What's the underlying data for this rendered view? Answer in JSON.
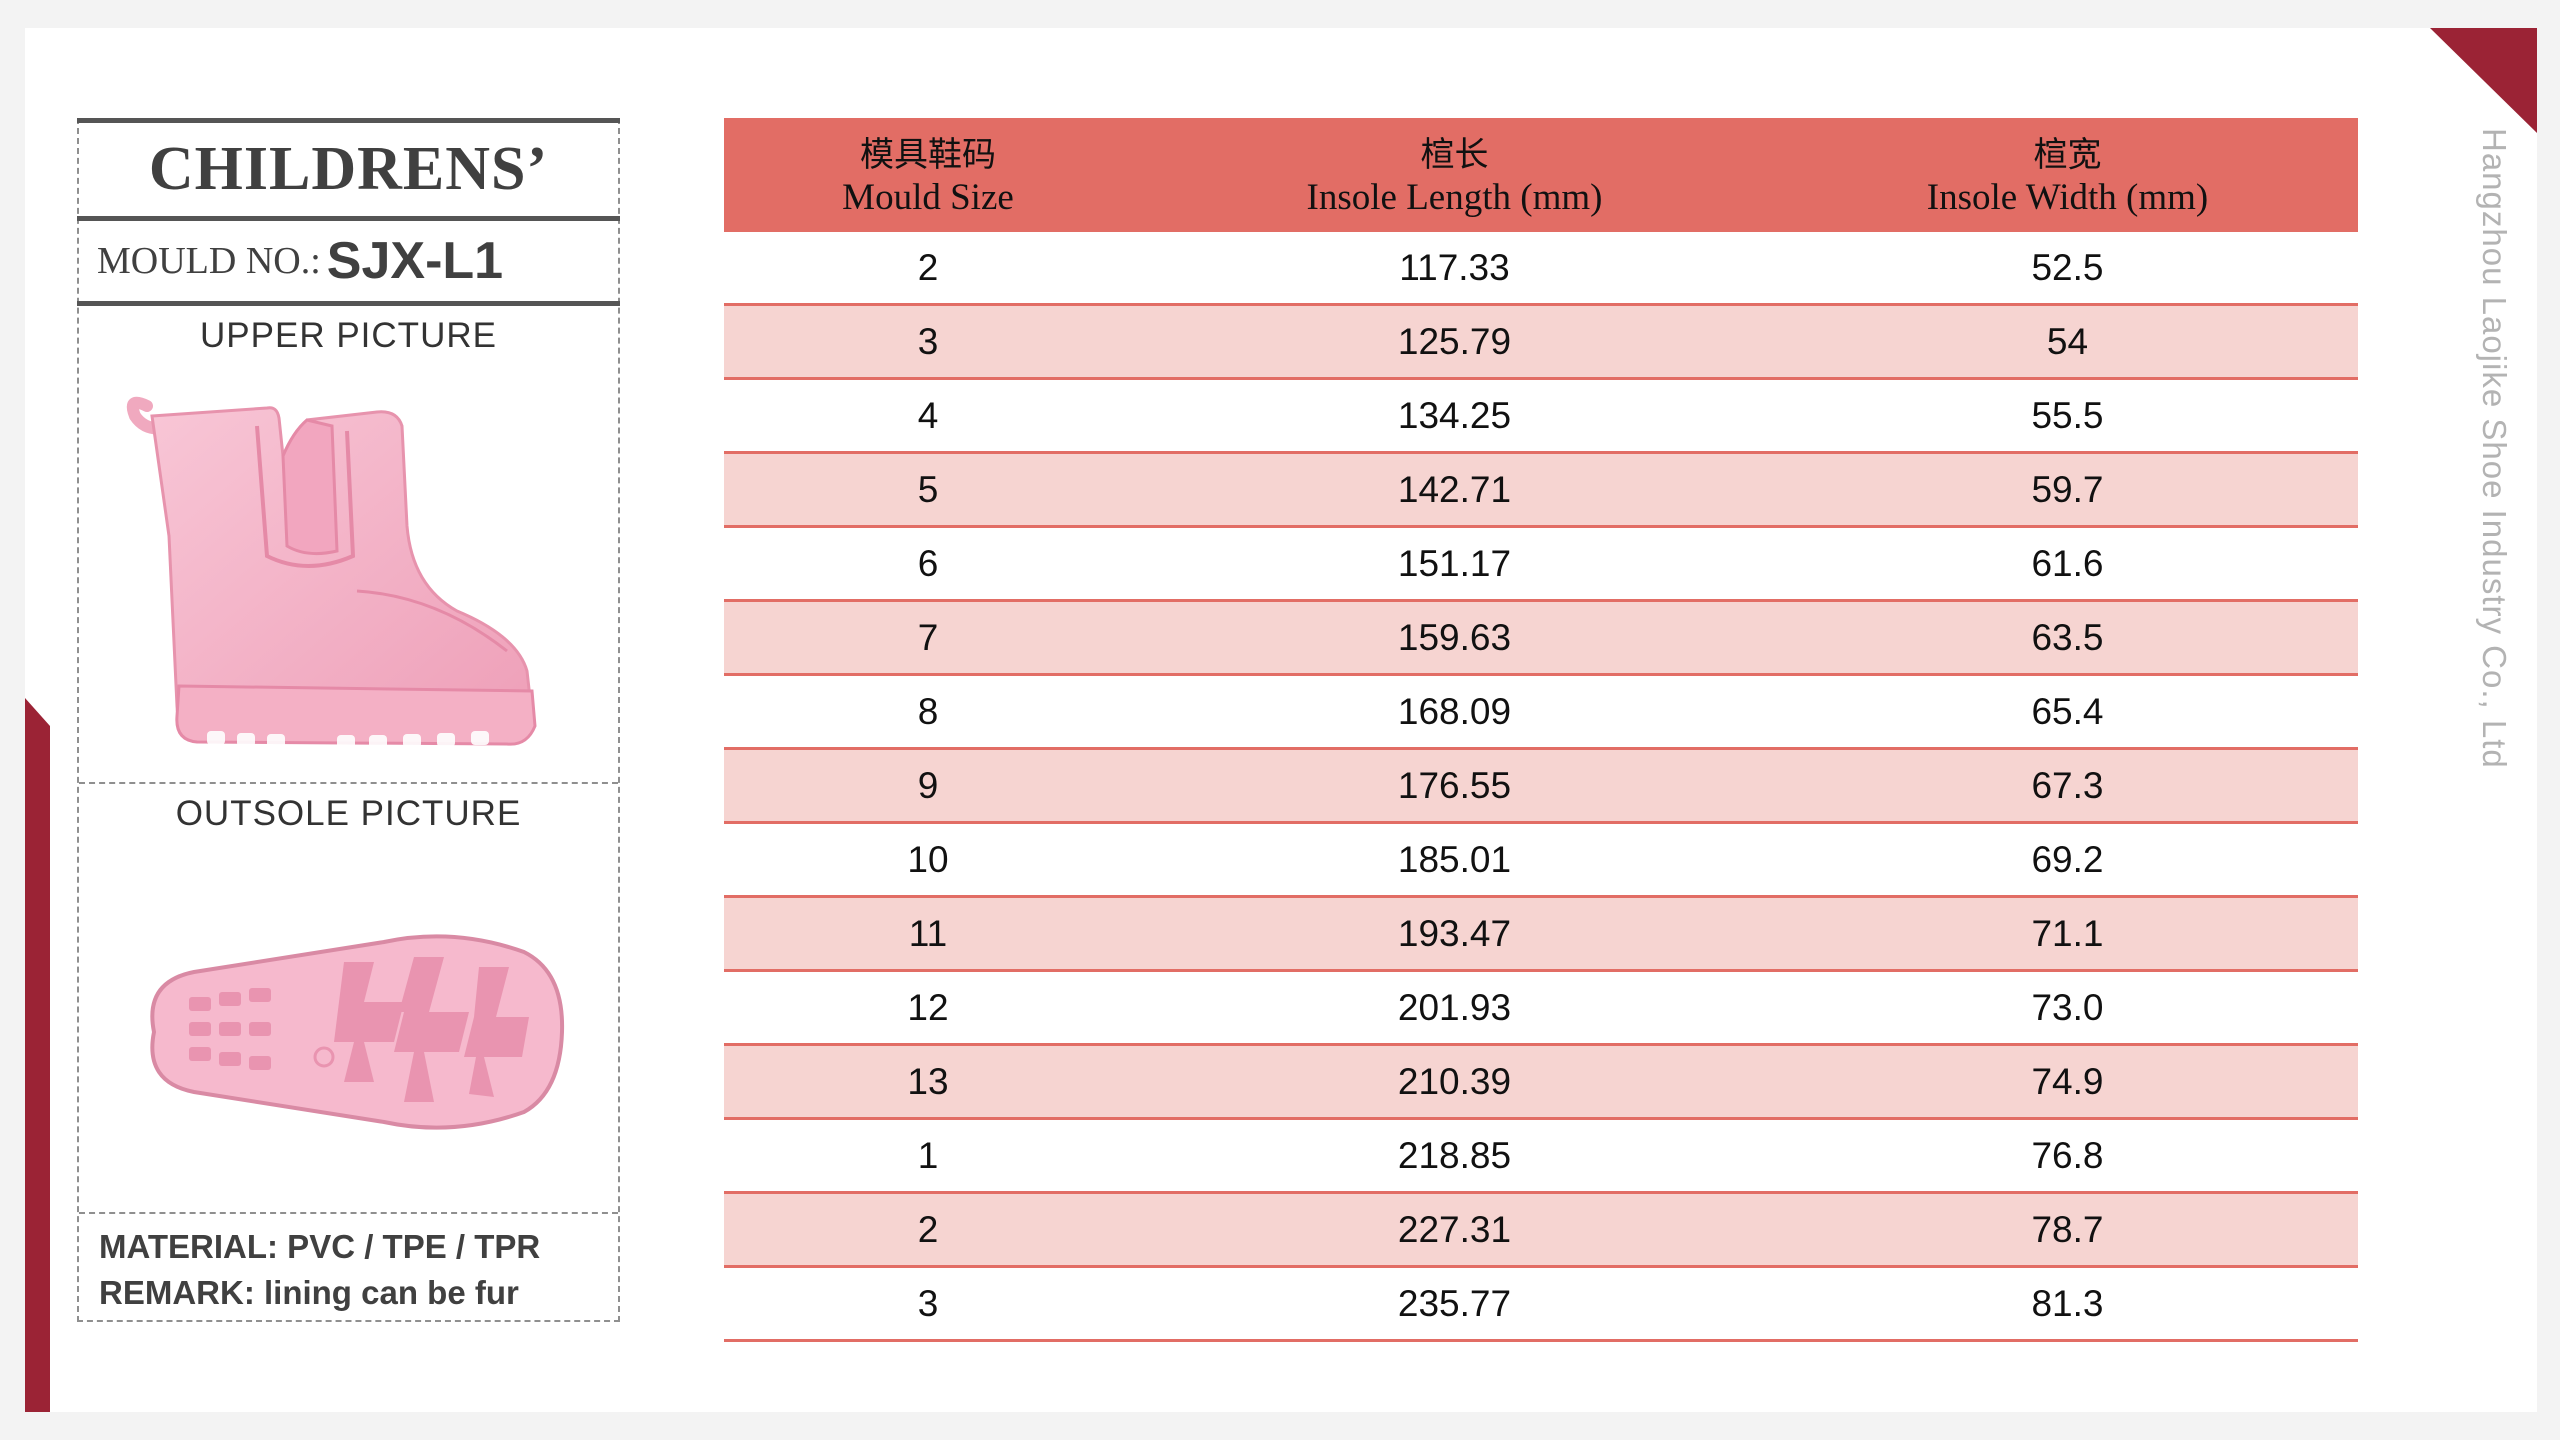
{
  "card": {
    "title": "CHILDRENS’",
    "mould_label": "MOULD NO.:",
    "mould_value": "SJX-L1",
    "upper_label": "UPPER PICTURE",
    "outsole_label": "OUTSOLE PICTURE",
    "material": "MATERIAL: PVC / TPE / TPR",
    "remark": "REMARK: lining can be fur"
  },
  "table": {
    "headers": [
      {
        "zh": "模具鞋码",
        "en": "Mould Size"
      },
      {
        "zh": "楦长",
        "en": "Insole Length (mm)"
      },
      {
        "zh": "楦宽",
        "en": "Insole Width (mm)"
      }
    ],
    "rows": [
      [
        "2",
        "117.33",
        "52.5"
      ],
      [
        "3",
        "125.79",
        "54"
      ],
      [
        "4",
        "134.25",
        "55.5"
      ],
      [
        "5",
        "142.71",
        "59.7"
      ],
      [
        "6",
        "151.17",
        "61.6"
      ],
      [
        "7",
        "159.63",
        "63.5"
      ],
      [
        "8",
        "168.09",
        "65.4"
      ],
      [
        "9",
        "176.55",
        "67.3"
      ],
      [
        "10",
        "185.01",
        "69.2"
      ],
      [
        "11",
        "193.47",
        "71.1"
      ],
      [
        "12",
        "201.93",
        "73.0"
      ],
      [
        "13",
        "210.39",
        "74.9"
      ],
      [
        "1",
        "218.85",
        "76.8"
      ],
      [
        "2",
        "227.31",
        "78.7"
      ],
      [
        "3",
        "235.77",
        "81.3"
      ]
    ]
  },
  "company": "Hangzhou Laojike Shoe Industry Co., Ltd",
  "colors": {
    "header_red": "#e26d65",
    "row_pink": "#f6d4d1",
    "accent_maroon": "#9b2335",
    "product_pink": "#f4b8cc"
  }
}
